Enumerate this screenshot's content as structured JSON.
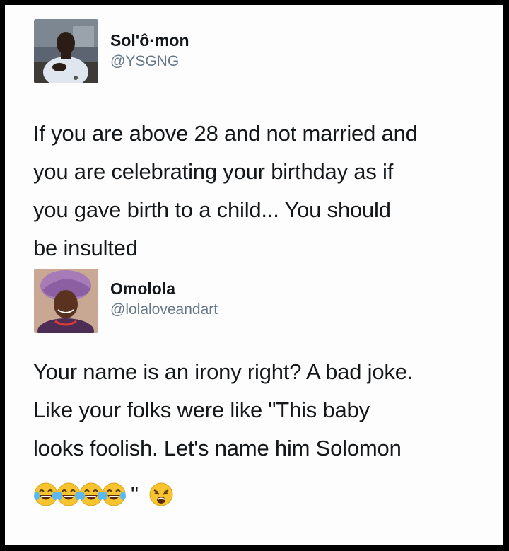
{
  "tweets": [
    {
      "display_name": "Sol'ô·mon",
      "handle": "@YSGNG",
      "text_lines": [
        "If you are above 28 and not married and",
        "you are celebrating your birthday as if",
        "you gave birth to a child... You should",
        "be insulted"
      ]
    },
    {
      "display_name": "Omolola",
      "handle": "@lolaloveandart",
      "text_lines": [
        "Your name is an irony right? A bad joke.",
        "Like your folks were like \"This baby",
        "looks foolish. Let's name him Solomon"
      ],
      "closing_quote": "\"",
      "emojis": [
        "tears-of-joy-emoji",
        "tears-of-joy-emoji",
        "tears-of-joy-emoji",
        "tears-of-joy-emoji",
        "weary-face-emoji"
      ]
    }
  ],
  "colors": {
    "frame": "#000000",
    "background": "#fdfdfd",
    "text": "#14171a",
    "handle": "#657786",
    "emoji_yellow": "#f7c32e"
  }
}
